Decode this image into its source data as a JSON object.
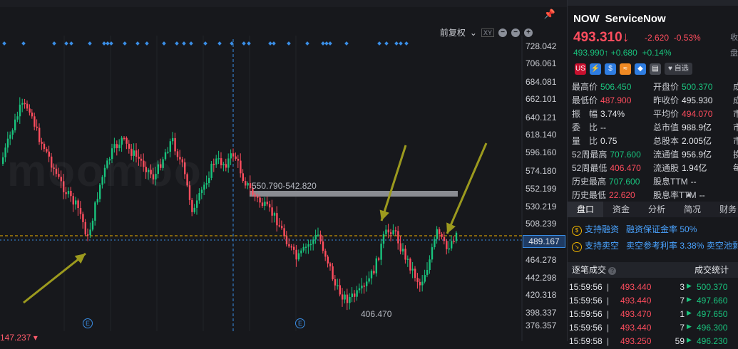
{
  "chart": {
    "toolbar": {
      "adjust_label": "前复权",
      "small_icon_label": "XY"
    },
    "price_axis": [
      "728.042",
      "706.061",
      "684.081",
      "662.101",
      "640.121",
      "618.140",
      "596.160",
      "574.180",
      "552.199",
      "530.219",
      "508.239",
      "489.167",
      "464.278",
      "442.298",
      "420.318",
      "398.337",
      "376.357"
    ],
    "current_price_tag": "489.167",
    "range_label": "550.790-542.820",
    "low_label": "406.470",
    "bottom_left_value": "147.237",
    "earnings_marker": "E",
    "watermark": "moomoo",
    "colors": {
      "up": "#19c37d",
      "down": "#ff4d5e",
      "range_bar": "#8a8c92",
      "arrow": "#9c9a1e",
      "current_line": "#f0b400",
      "crosshair": "#3a8ee6"
    }
  },
  "quote": {
    "ticker": "NOW",
    "name": "ServiceNow",
    "price": "493.310",
    "arrow": "↓",
    "change": "-2.620",
    "change_pct": "-0.53%",
    "post_price": "493.990",
    "post_arrow": "↑",
    "post_change": "+0.680",
    "post_change_pct": "+0.14%",
    "add_watchlist": "自选",
    "badges": [
      "US",
      "⚡",
      "$",
      "≈",
      "◆",
      "▤"
    ],
    "cut_right": [
      "收",
      "盘"
    ]
  },
  "stats": [
    {
      "label": "最高价",
      "value": "506.450",
      "tone": "up",
      "label2": "开盘价",
      "value2": "500.370",
      "tone2": "up",
      "cut": "成"
    },
    {
      "label": "最低价",
      "value": "487.900",
      "tone": "down",
      "label2": "昨收价",
      "value2": "495.930",
      "tone2": "",
      "cut": "成"
    },
    {
      "label": "振　幅",
      "value": "3.74%",
      "tone": "",
      "label2": "平均价",
      "value2": "494.070",
      "tone2": "down",
      "cut": "市"
    },
    {
      "label": "委　比",
      "value": "--",
      "tone": "",
      "label2": "总市值",
      "value2": "988.9亿",
      "tone2": "",
      "cut": "市"
    },
    {
      "label": "量　比",
      "value": "0.75",
      "tone": "",
      "label2": "总股本",
      "value2": "2.005亿",
      "tone2": "",
      "cut": "市"
    },
    {
      "label": "52周最高",
      "value": "707.600",
      "tone": "up",
      "label2": "流通值",
      "value2": "956.9亿",
      "tone2": "",
      "cut": "换"
    },
    {
      "label": "52周最低",
      "value": "406.470",
      "tone": "down",
      "label2": "流通股",
      "value2": "1.94亿",
      "tone2": "",
      "cut": "每"
    },
    {
      "label": "历史最高",
      "value": "707.600",
      "tone": "up",
      "label2": "股息TTM",
      "value2": "--",
      "tone2": "",
      "cut": ""
    },
    {
      "label": "历史最低",
      "value": "22.620",
      "tone": "down",
      "label2": "股息率TTM",
      "value2": "--",
      "tone2": "",
      "cut": ""
    }
  ],
  "tabs": [
    "盘口",
    "资金",
    "分析",
    "简况",
    "财务"
  ],
  "margin": [
    {
      "link": "支持融资",
      "text": "融资保证金率 50%"
    },
    {
      "link": "支持卖空",
      "text": "卖空参考利率 3.38% 卖空池剩"
    }
  ],
  "ticks": {
    "title": "逐笔成交",
    "stats_title": "成交统计",
    "rows": [
      {
        "time": "15:59:56",
        "bar": "|",
        "price": "493.440",
        "qty": "3",
        "arrow": "▶",
        "level_price": "500.370"
      },
      {
        "time": "15:59:56",
        "bar": "|",
        "price": "493.440",
        "qty": "7",
        "arrow": "▶",
        "level_price": "497.660"
      },
      {
        "time": "15:59:56",
        "bar": "|",
        "price": "493.470",
        "qty": "1",
        "arrow": "▶",
        "level_price": "497.650"
      },
      {
        "time": "15:59:56",
        "bar": "|",
        "price": "493.440",
        "qty": "7",
        "arrow": "▶",
        "level_price": "496.300"
      },
      {
        "time": "15:59:58",
        "bar": "|",
        "price": "493.250",
        "qty": "59",
        "arrow": "▶",
        "level_price": "496.230"
      }
    ]
  }
}
